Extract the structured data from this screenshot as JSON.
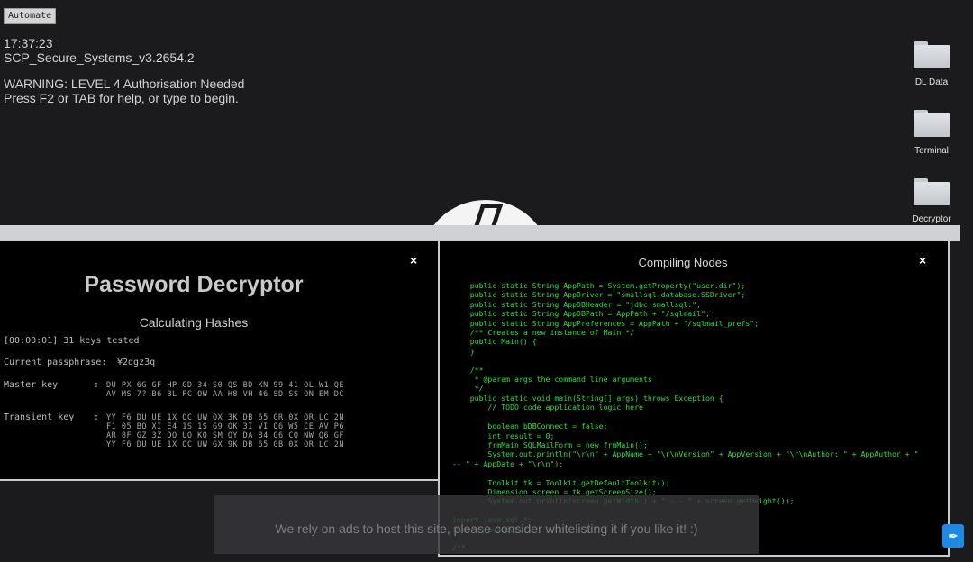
{
  "toolbar": {
    "automate_label": "Automate"
  },
  "terminal": {
    "time": "17:37:23",
    "system": "SCP_Secure_Systems_v3.2654.2",
    "warning": "WARNING: LEVEL 4 Authorisation Needed",
    "help": "Press F2 or TAB for help, or type to begin."
  },
  "desktop": {
    "icons": [
      {
        "label": "DL Data",
        "icon": "folder-icon"
      },
      {
        "label": "Terminal",
        "icon": "folder-icon"
      },
      {
        "label": "Decryptor",
        "icon": "folder-icon"
      }
    ]
  },
  "password_decryptor": {
    "title": "Password Decryptor",
    "subtitle": "Calculating Hashes",
    "keys_tested": "[00:00:01] 31 keys tested",
    "passphrase_label": "Current passphrase:",
    "passphrase_value": "¥2dgz3q",
    "master_key_label": "Master key",
    "master_key_lines": [
      "DU PX 6G GF HP GD 34 S0 QS BD KN 99 41 OL W1 QE",
      "AV MS 7? B6 BL FC OW AA H8 VH 46 SD SS ON EM DC"
    ],
    "transient_key_label": "Transient key",
    "transient_key_lines": [
      "YY F6 DU UE 1X OC UW OX 3K DB 65 GR 0X OR LC 2N",
      "F1 05 BO XI E4 1S 1S G9 OK 3I VI O6 W5 CE AV P6",
      "AR 8F GZ 3Z DO UO KO SM OY DA 84 G6 CO NW Q6 GF",
      "YY F6 DU UE 1X OC UW GX 9K DB 65 GB 0X OR LC 2N"
    ]
  },
  "compiling_nodes": {
    "title": "Compiling Nodes",
    "code_lines": [
      "    public static String AppPath = System.getProperty(\"user.dir\");",
      "    public static String AppDriver = \"smallsql.database.SSDriver\";",
      "    public static String AppDBHeader = \"jdbc:smallsql:\";",
      "    public static String AppDBPath = AppPath + \"/sqlmail\";",
      "    public static String AppPreferences = AppPath + \"/sqlmail_prefs\";",
      "    /** Creates a new instance of Main */",
      "    public Main() {",
      "    }",
      "",
      "    /**",
      "     * @param args the command line arguments",
      "     */",
      "    public static void main(String[] args) throws Exception {",
      "        // TODO code application logic here",
      "",
      "        boolean bDBConnect = false;",
      "        int result = 0;",
      "        frmMain SQLMailForm = new frmMain();",
      "        System.out.println(\"\\r\\n\" + AppName + \"\\r\\nVersion\" + AppVersion + \"\\r\\nAuthor: \" + AppAuthor + \"",
      "-- \" + AppDate + \"\\r\\n\");",
      "",
      "        Toolkit tk = Toolkit.getDefaultToolkit();",
      "        Dimension screen = tk.getScreenSize();",
      "        System.out.println(screen.getWidth() + \" --- \" + screen.getHeight());",
      "",
      "import java.sql.*;",
      "import java.awt.*;",
      "",
      "/**"
    ]
  },
  "ad_banner": {
    "text": "We rely on ads to host this site, please consider whitelisting it if you like it! :)"
  },
  "close_glyph": "×"
}
